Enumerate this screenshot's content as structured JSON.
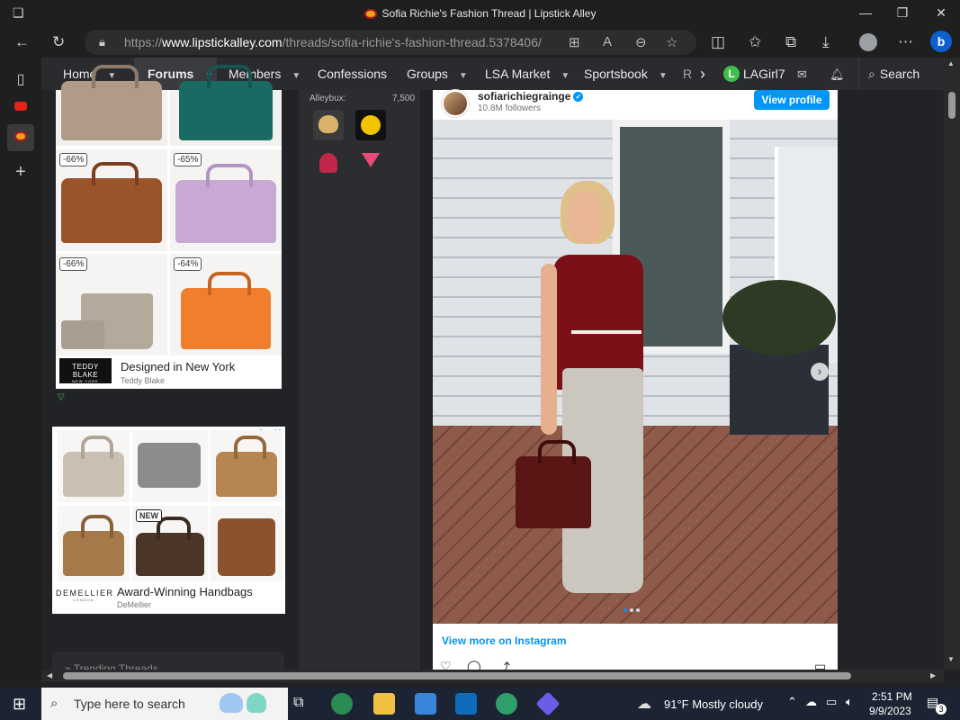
{
  "window": {
    "title": "Sofia Richie's Fashion Thread | Lipstick Alley",
    "minimize": "—",
    "restore": "❐",
    "close": "✕"
  },
  "browser": {
    "url_prefix": "https://",
    "url_domain": "www.lipstickalley.com",
    "url_path": "/threads/sofia-richie's-fashion-thread.5378406/"
  },
  "nav": {
    "items": [
      {
        "label": "Home",
        "caret": true
      },
      {
        "label": "Forums",
        "caret": true,
        "active": true
      },
      {
        "label": "Members",
        "caret": true
      },
      {
        "label": "Confessions",
        "caret": false
      },
      {
        "label": "Groups",
        "caret": true
      },
      {
        "label": "LSA Market",
        "caret": true
      },
      {
        "label": "Sportsbook",
        "caret": true
      },
      {
        "label": "R",
        "caret": false
      }
    ],
    "user_initial": "L",
    "user_name": "LAGirl7",
    "search_label": "Search"
  },
  "ad1": {
    "discounts": [
      "-66%",
      "-65%",
      "-66%",
      "-64%"
    ],
    "brand_logo": "TEDDY BLAKE",
    "brand_logo_sub": "NEW YORK",
    "headline": "Designed in New York",
    "advertiser": "Teddy Blake"
  },
  "ad2": {
    "new_badge": "NEW",
    "brand_logo": "DEMELLIER",
    "brand_logo_sub": "LONDON",
    "headline": "Award-Winning Handbags",
    "advertiser": "DeMellier"
  },
  "trending": {
    "label": "» Trending Threads"
  },
  "middle": {
    "alleybux_label": "Alleybux:",
    "alleybux_value": "7,500"
  },
  "instagram": {
    "username": "sofiarichiegrainge",
    "followers": "10.8M followers",
    "view_profile": "View profile",
    "view_more": "View more on Instagram"
  },
  "taskbar": {
    "search_placeholder": "Type here to search",
    "weather": "91°F  Mostly cloudy",
    "time": "2:51 PM",
    "date": "9/9/2023",
    "notifications": "3"
  },
  "colors": {
    "accent": "#0095f6",
    "page_bg": "#222326",
    "nav_bg": "#2a2b2f",
    "online_green": "#3fbf4a"
  }
}
